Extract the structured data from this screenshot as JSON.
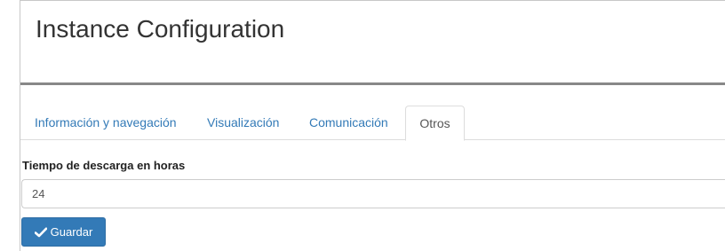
{
  "page": {
    "title": "Instance Configuration"
  },
  "tabs": [
    {
      "label": "Información y navegación",
      "active": false
    },
    {
      "label": "Visualización",
      "active": false
    },
    {
      "label": "Comunicación",
      "active": false
    },
    {
      "label": "Otros",
      "active": true
    }
  ],
  "form": {
    "download_time_label": "Tiempo de descarga en horas",
    "download_time_value": "24",
    "save_label": "Guardar",
    "save_icon": "check-icon"
  },
  "colors": {
    "link": "#337ab7",
    "primary_button": "#337ab7",
    "title_rule": "#888888"
  }
}
